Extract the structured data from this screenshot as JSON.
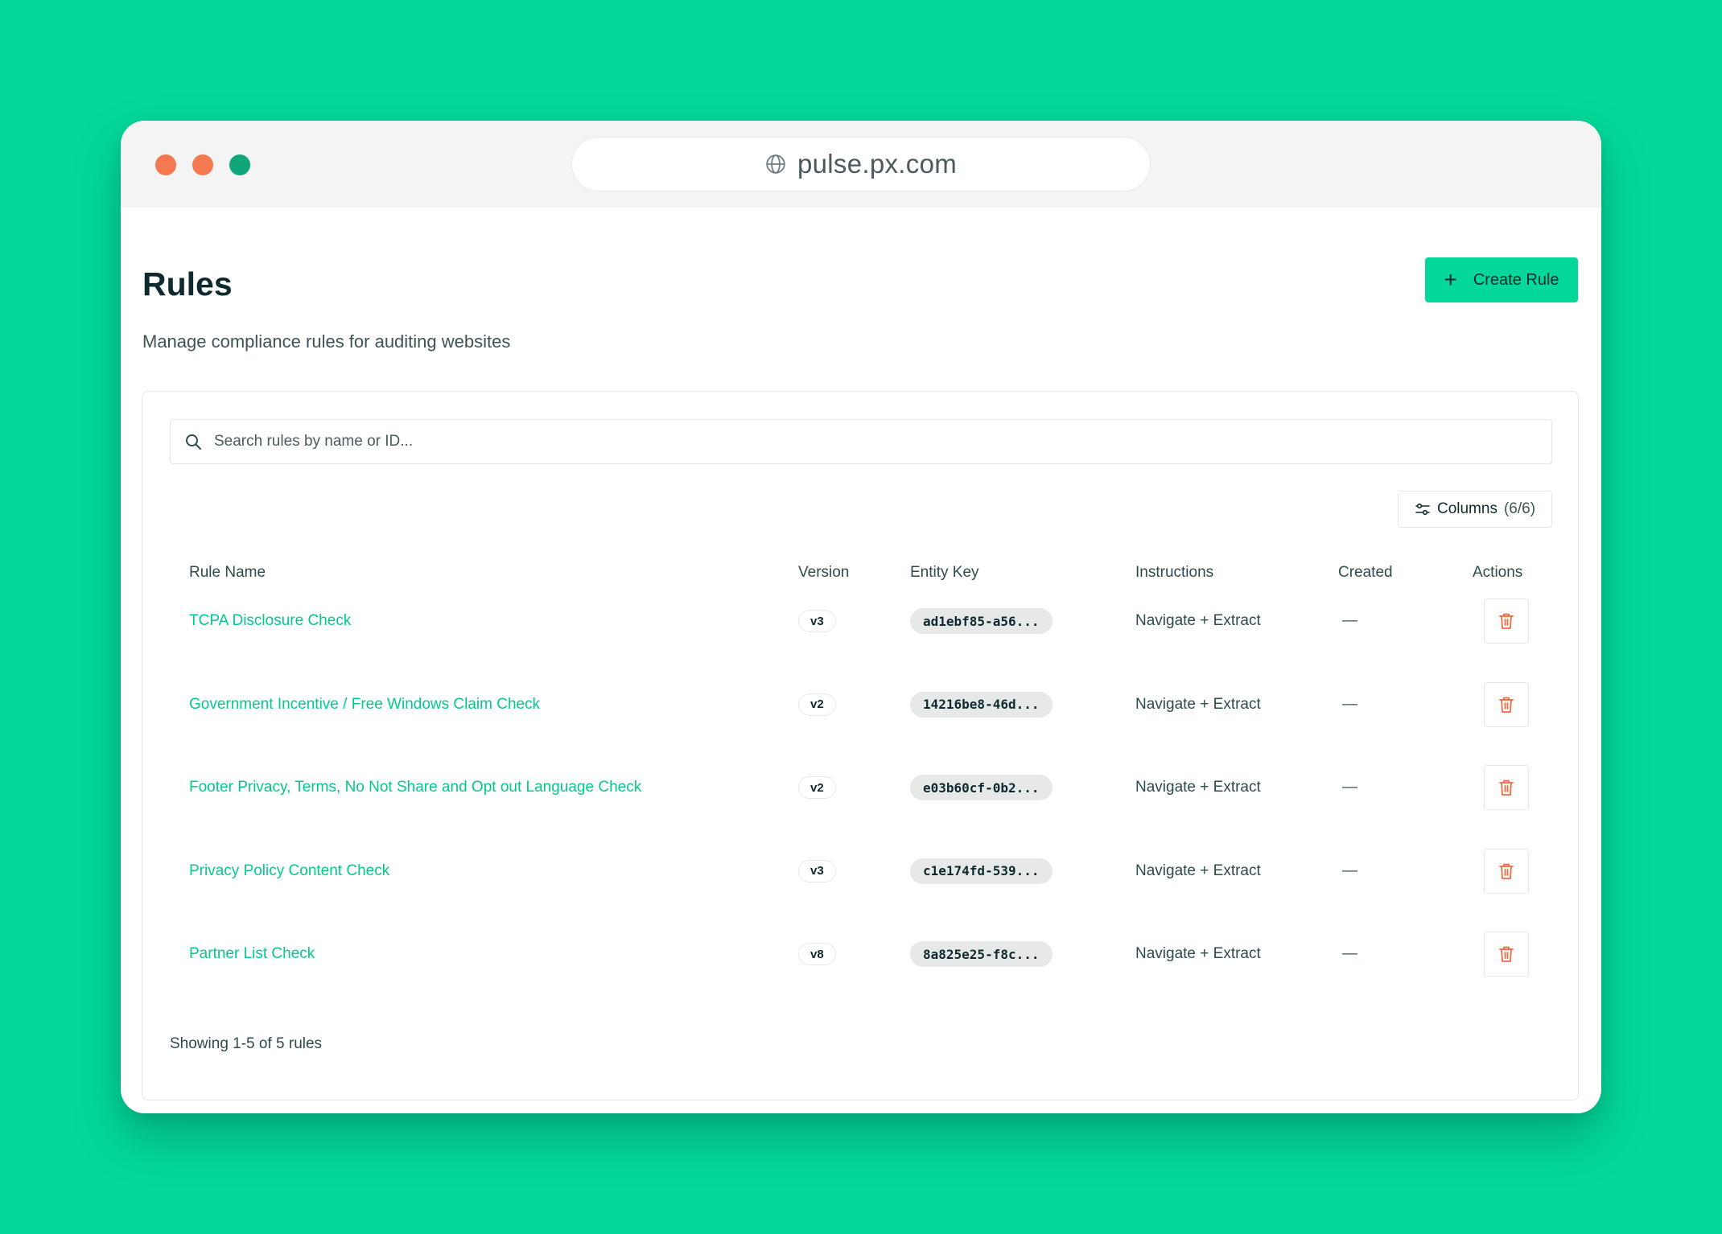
{
  "browser": {
    "url": "pulse.px.com"
  },
  "header": {
    "title": "Rules",
    "subtitle": "Manage compliance rules for auditing websites",
    "create_label": "Create Rule"
  },
  "search": {
    "placeholder": "Search rules by name or ID..."
  },
  "columns_button": {
    "label": "Columns",
    "count": "(6/6)"
  },
  "table": {
    "headers": [
      "Rule Name",
      "Version",
      "Entity Key",
      "Instructions",
      "Created",
      "Actions"
    ],
    "rows": [
      {
        "name": "TCPA Disclosure Check",
        "version": "v3",
        "entity_key": "ad1ebf85-a56...",
        "instructions": "Navigate + Extract",
        "created": "—"
      },
      {
        "name": "Government Incentive / Free Windows Claim Check",
        "version": "v2",
        "entity_key": "14216be8-46d...",
        "instructions": "Navigate + Extract",
        "created": "—"
      },
      {
        "name": "Footer Privacy, Terms, No Not Share and Opt out Language Check",
        "version": "v2",
        "entity_key": "e03b60cf-0b2...",
        "instructions": "Navigate + Extract",
        "created": "—"
      },
      {
        "name": "Privacy Policy Content Check",
        "version": "v3",
        "entity_key": "c1e174fd-539...",
        "instructions": "Navigate + Extract",
        "created": "—"
      },
      {
        "name": "Partner List Check",
        "version": "v8",
        "entity_key": "8a825e25-f8c...",
        "instructions": "Navigate + Extract",
        "created": "—"
      }
    ]
  },
  "footer": {
    "summary": "Showing 1-5 of 5 rules"
  },
  "colors": {
    "background": "#03d89a",
    "accent": "#03d89a",
    "link": "#03c98d",
    "danger": "#f06a45",
    "text_dark": "#0f2a2e"
  },
  "icons": {
    "url": "globe-icon",
    "search": "search-icon",
    "columns": "sliders-icon",
    "delete": "trash-icon",
    "create": "plus-icon"
  }
}
